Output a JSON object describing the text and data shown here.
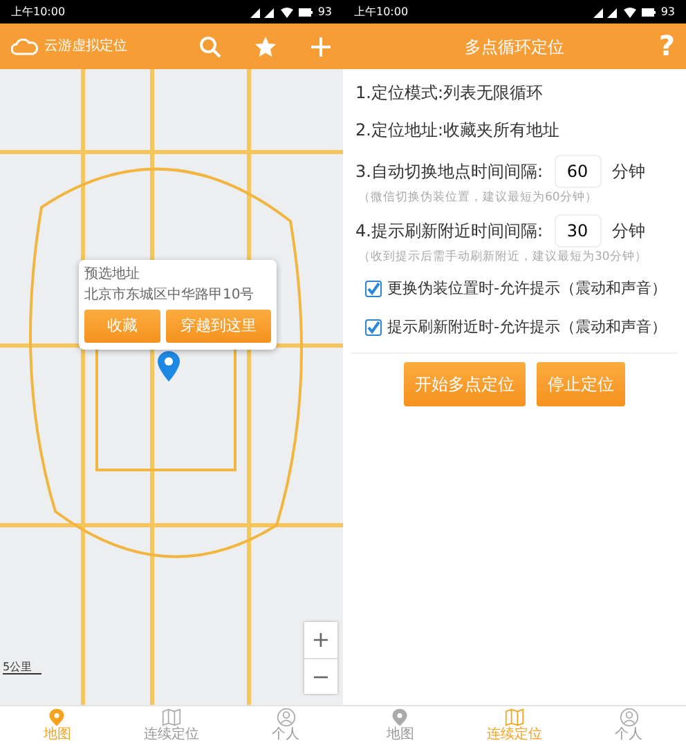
{
  "left": {
    "status_bar": {
      "time": "上午10:00",
      "battery": "93"
    },
    "header": {
      "title": "云游虚拟定位"
    },
    "map": {
      "popup": {
        "title": "预选地址",
        "address": "北京市东城区中华路甲10号",
        "buttons": [
          "收藏",
          "穿越到这里"
        ]
      },
      "zoom": [
        "+",
        "−"
      ],
      "scale": "5公里"
    },
    "nav": [
      {
        "label": "地图",
        "selected": true
      },
      {
        "label": "连续定位",
        "selected": false
      },
      {
        "label": "个人",
        "selected": false
      }
    ]
  },
  "right": {
    "status_bar": {
      "time": "上午10:00",
      "battery": "93"
    },
    "header": {
      "title": "多点循环定位",
      "help": "?"
    },
    "settings": [
      {
        "kind": "text",
        "label": "1.定位模式:列表无限循环"
      },
      {
        "kind": "text",
        "label": "2.定位地址:收藏夹所有地址"
      },
      {
        "kind": "interval",
        "label": "3.自动切换地点时间间隔:",
        "value": "60",
        "unit": "分钟",
        "hint": "（微信切换伪装位置，建议最短为60分钟）"
      },
      {
        "kind": "interval",
        "label": "4.提示刷新附近时间间隔:",
        "value": "30",
        "unit": "分钟",
        "hint": "（收到提示后需手动刷新附近，建议最短为30分钟）"
      },
      {
        "kind": "checkbox",
        "label": "更换伪装位置时-允许提示（震动和声音）",
        "checked": true
      },
      {
        "kind": "checkbox",
        "label": "提示刷新附近时-允许提示（震动和声音）",
        "checked": true
      }
    ],
    "buttons": [
      "开始多点定位",
      "停止定位"
    ],
    "nav": [
      {
        "label": "地图",
        "selected": false
      },
      {
        "label": "连续定位",
        "selected": true
      },
      {
        "label": "个人",
        "selected": false
      }
    ]
  }
}
